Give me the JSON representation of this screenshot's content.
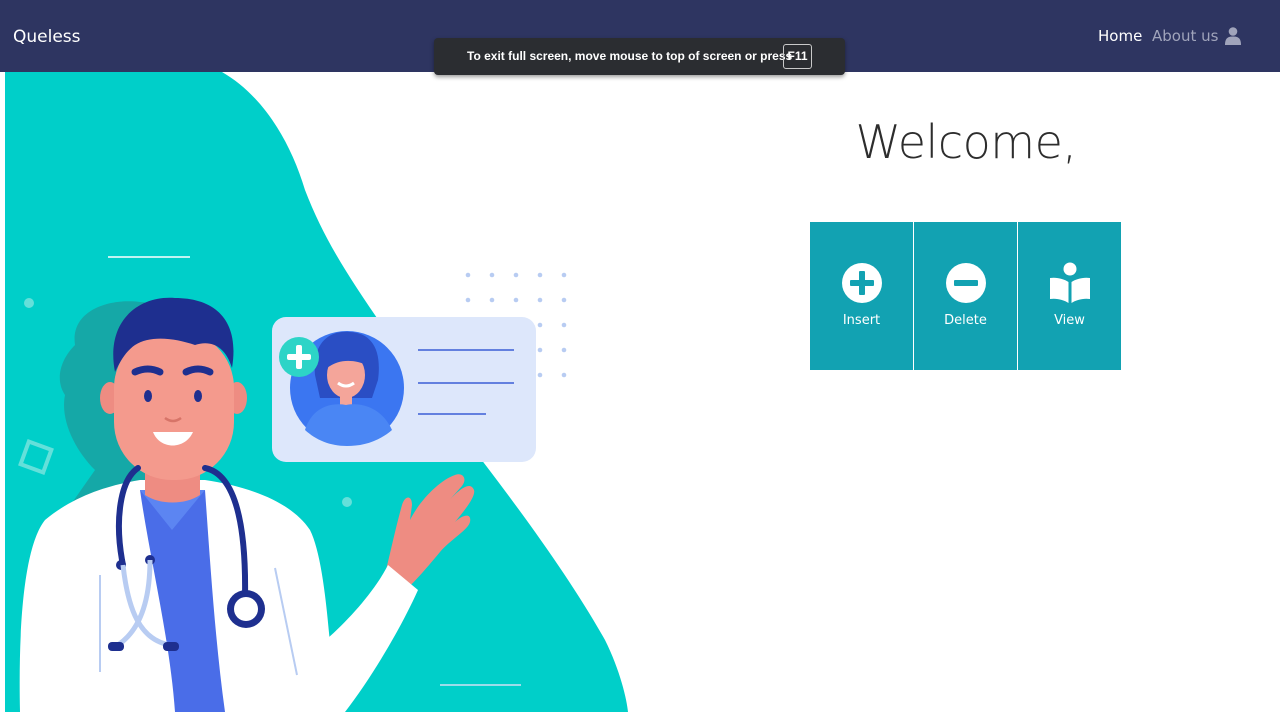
{
  "navbar": {
    "brand": "Queless",
    "links": {
      "home": "Home",
      "about": "About us"
    },
    "user_icon": "user-icon",
    "background": "#2e3561"
  },
  "fullscreen_notice": {
    "text": "To exit full screen, move mouse to top of screen or press",
    "key": "F11"
  },
  "hero": {
    "illustration": "doctor-with-patient-card-illustration",
    "accent": "#00cfc9"
  },
  "main": {
    "welcome": "Welcome,",
    "tiles": [
      {
        "label": "Insert",
        "icon": "plus-circle-icon"
      },
      {
        "label": "Delete",
        "icon": "minus-circle-icon"
      },
      {
        "label": "View",
        "icon": "book-reader-icon"
      }
    ],
    "tile_color": "#12a2b2"
  }
}
